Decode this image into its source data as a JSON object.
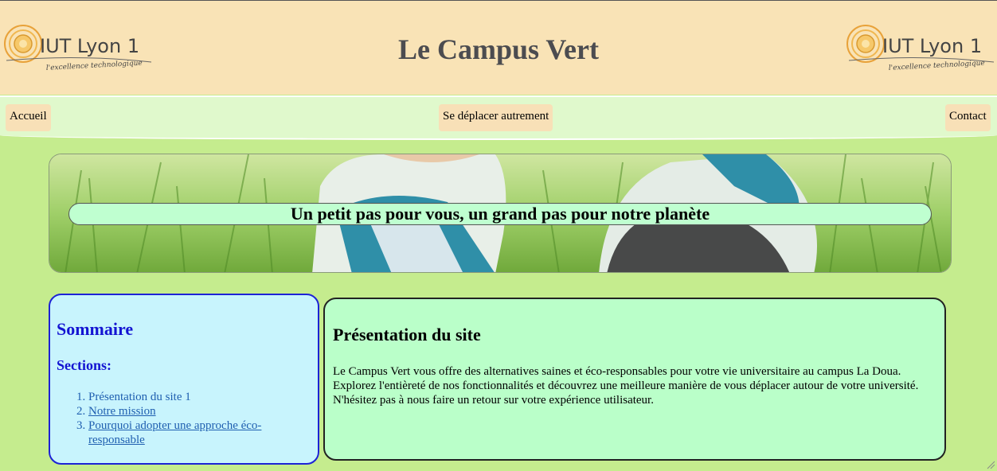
{
  "header": {
    "title": "Le Campus Vert",
    "logo_left": {
      "name": "IUT Lyon 1",
      "tagline": "l'excellence technologique"
    },
    "logo_right": {
      "name": "IUT Lyon 1",
      "tagline": "l'excellence technologique"
    }
  },
  "nav": {
    "home": "Accueil",
    "move": "Se déplacer autrement",
    "contact": "Contact"
  },
  "banner": {
    "tagline": "Un petit pas pour vous, un grand pas pour notre planète"
  },
  "sommaire": {
    "title": "Sommaire",
    "subtitle": "Sections:",
    "items": [
      {
        "label": "Présentation du site 1"
      },
      {
        "label": "Notre mission"
      },
      {
        "label": "Pourquoi adopter une approche éco-responsable"
      }
    ]
  },
  "presentation": {
    "title": "Présentation du site",
    "text": "Le Campus Vert vous offre des alternatives saines et éco-responsables pour votre vie universitaire au campus La Doua. Explorez l'entièreté de nos fonctionnalités et découvrez une meilleure manière de vous déplacer autour de votre université. N'hésitez pas à nous faire un retour sur votre expérience utilisateur."
  },
  "colors": {
    "page_bg": "#c5ec8e",
    "header_bg": "#f9e3b6",
    "nav_bg": "#e0f9cc",
    "sommaire_bg": "#c8f4fd",
    "sommaire_accent": "#1414d2",
    "presentation_bg": "#baffc9",
    "tagline_bg": "#bfffd0"
  }
}
